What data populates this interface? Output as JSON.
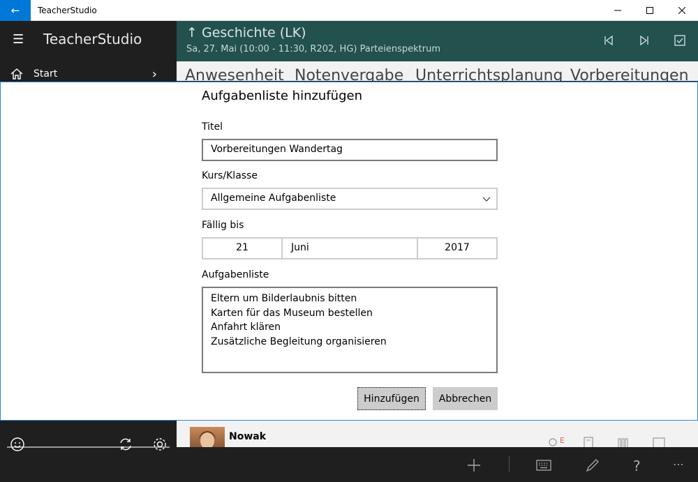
{
  "window": {
    "title": "TeacherStudio",
    "accent": "#0078d7"
  },
  "sidebar": {
    "brand": "TeacherStudio",
    "nav_start": "Start"
  },
  "header": {
    "course_title": "Geschichte (LK)",
    "course_subtitle": "Sa, 27. Mai (10:00 - 11:30, R202, HG) Parteienspektrum",
    "color": "#22514e"
  },
  "tabs": [
    {
      "label": "Anwesenheit"
    },
    {
      "label": "Notenvergabe"
    },
    {
      "label": "Unterrichtsplanung"
    },
    {
      "label": "Vorbereitungen"
    }
  ],
  "dialog": {
    "title": "Aufgabenliste hinzufügen",
    "title_label": "Titel",
    "title_value": "Vorbereitungen Wandertag",
    "course_label": "Kurs/Klasse",
    "course_value": "Allgemeine Aufgabenliste",
    "due_label": "Fällig bis",
    "due_day": "21",
    "due_month": "Juni",
    "due_year": "2017",
    "list_label": "Aufgabenliste",
    "list_items": [
      "Eltern um Bilderlaubnis bitten",
      "Karten für das Museum bestellen",
      "Anfahrt klären",
      "Zusätzliche Begleitung organisieren"
    ],
    "add_button": "Hinzufügen",
    "cancel_button": "Abbrechen"
  },
  "content": {
    "student_name": "Nowak",
    "badge_letter": "E"
  },
  "icons": {
    "back": "back-arrow-icon",
    "menu": "hamburger-icon",
    "home": "home-icon",
    "sync": "sync-icon",
    "settings": "gear-icon",
    "add": "plus-icon",
    "edit": "pencil-icon",
    "help": "question-icon",
    "more": "ellipsis-icon"
  }
}
